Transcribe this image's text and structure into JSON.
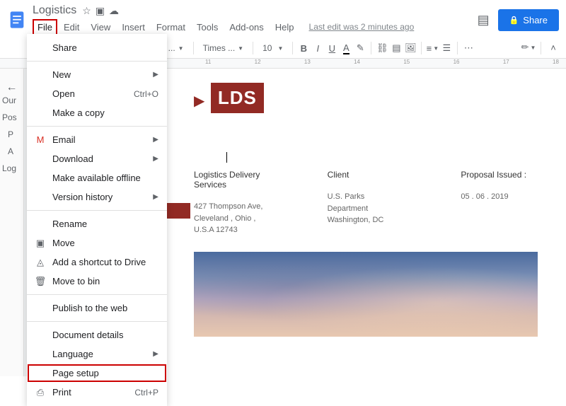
{
  "header": {
    "title": "Logistics",
    "last_edit": "Last edit was 2 minutes ago",
    "share_label": "Share"
  },
  "menubar": [
    "File",
    "Edit",
    "View",
    "Insert",
    "Format",
    "Tools",
    "Add-ons",
    "Help"
  ],
  "toolbar": {
    "style": "mal ...",
    "font": "Times ...",
    "size": "10"
  },
  "ruler_marks": [
    "11",
    "12",
    "13",
    "14",
    "15",
    "16",
    "17",
    "18"
  ],
  "outline": [
    "Our",
    "Pos",
    "P",
    "A",
    "Log"
  ],
  "file_menu": {
    "share": "Share",
    "new": "New",
    "open": "Open",
    "open_shortcut": "Ctrl+O",
    "make_copy": "Make a copy",
    "email": "Email",
    "download": "Download",
    "offline": "Make available offline",
    "version_history": "Version history",
    "rename": "Rename",
    "move": "Move",
    "shortcut_drive": "Add a shortcut to Drive",
    "move_bin": "Move to bin",
    "publish": "Publish to the web",
    "doc_details": "Document details",
    "language": "Language",
    "page_setup": "Page setup",
    "print": "Print",
    "print_shortcut": "Ctrl+P"
  },
  "document": {
    "lds": "LDS",
    "col1_hdr": "Logistics Delivery Services",
    "col1_body": "427 Thompson Ave, Cleveland , Ohio , U.S.A 12743",
    "col2_hdr": "Client",
    "col2_body": "U.S. Parks Department Washington, DC",
    "col3_hdr": "Proposal Issued :",
    "col3_body": "05 . 06 . 2019"
  }
}
